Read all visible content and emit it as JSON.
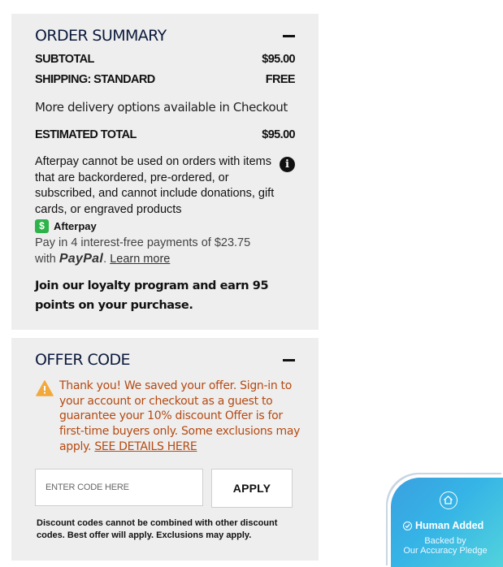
{
  "order_summary": {
    "title": "ORDER SUMMARY",
    "subtotal_label": "SUBTOTAL",
    "subtotal_value": "$95.00",
    "shipping_label": "SHIPPING: STANDARD",
    "shipping_value": "FREE",
    "delivery_note": "More delivery options available in Checkout",
    "estimated_total_label": "ESTIMATED TOTAL",
    "estimated_total_value": "$95.00",
    "afterpay_notice": "Afterpay cannot be used on orders with items that are backordered, pre-ordered, or subscribed, and cannot include donations, gift cards, or engraved products",
    "afterpay_badge": "$",
    "afterpay_label": "Afterpay",
    "pay_in_4": "Pay in 4 interest-free payments of $23.75",
    "with_text": "with",
    "paypal_text": "PayPal",
    "learn_more": "Learn more",
    "loyalty_text": "Join our loyalty program and earn 95 points on your purchase."
  },
  "offer_code": {
    "title": "OFFER CODE",
    "message": "Thank you! We saved your offer. Sign-in to your account or checkout as a guest to guarantee your 10% discount Offer is for first-time buyers only. Some exclusions may apply.",
    "details_link": "SEE DETAILS HERE",
    "input_placeholder": "ENTER CODE HERE",
    "input_value": "",
    "apply_label": "APPLY",
    "disclaimer": "Discount codes cannot be combined with other discount codes. Best offer will apply. Exclusions may apply."
  },
  "badge": {
    "title": "Human Added",
    "sub_line1": "Backed by",
    "sub_line2": "Our Accuracy Pledge"
  },
  "icons": {
    "collapse": "minus-icon",
    "info": "info-icon",
    "warning": "warning-icon",
    "afterpay": "afterpay-dollar-icon",
    "badge_home": "home-icon",
    "badge_check": "check-circle-icon"
  },
  "colors": {
    "panel_bg": "#eeeeee",
    "title_navy": "#0c1a3c",
    "warning_text": "#b54a12",
    "warning_icon": "#f2a93b",
    "afterpay_green": "#2db34a",
    "badge_gradient_start": "#3aa0e0",
    "badge_gradient_end": "#52d3dc"
  }
}
